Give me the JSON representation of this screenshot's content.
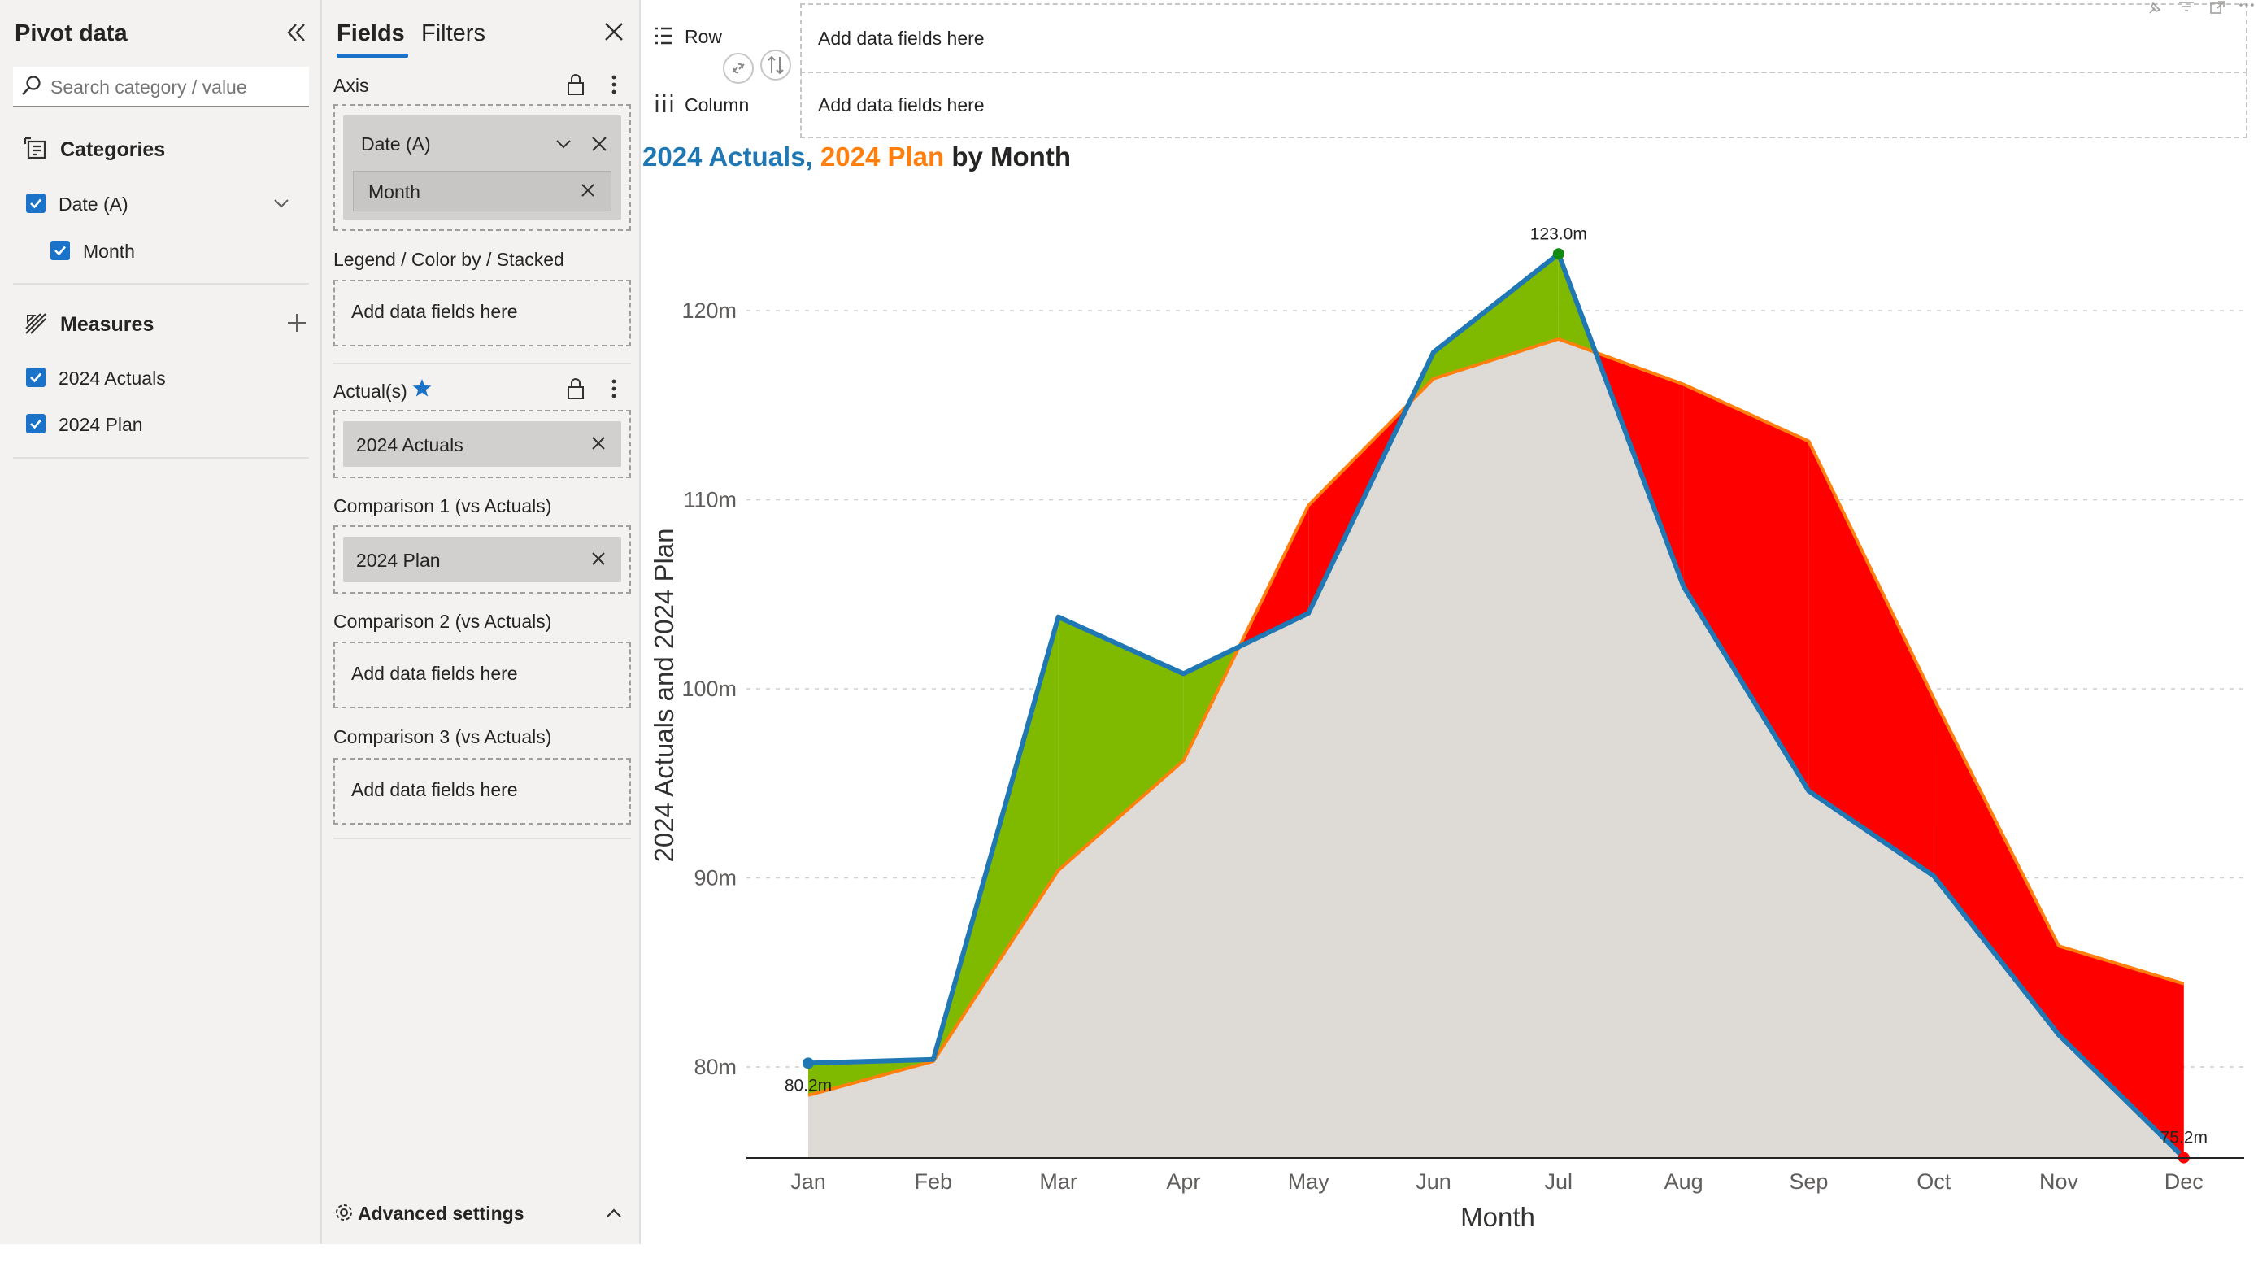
{
  "pivot": {
    "title": "Pivot data",
    "search_placeholder": "Search category / value",
    "categories_label": "Categories",
    "categories": [
      {
        "label": "Date (A)",
        "checked": true
      },
      {
        "label": "Month",
        "checked": true
      }
    ],
    "measures_label": "Measures",
    "measures": [
      {
        "label": "2024 Actuals",
        "checked": true
      },
      {
        "label": "2024 Plan",
        "checked": true
      }
    ]
  },
  "fields": {
    "tabs": [
      "Fields",
      "Filters"
    ],
    "active_tab": "Fields",
    "axis_label": "Axis",
    "axis_field": "Date (A)",
    "axis_sub_field": "Month",
    "legend_label": "Legend / Color by / Stacked",
    "legend_placeholder": "Add data fields here",
    "actuals_label": "Actual(s)",
    "actuals_field": "2024 Actuals",
    "comparison1_label": "Comparison 1 (vs Actuals)",
    "comparison1_field": "2024 Plan",
    "comparison2_label": "Comparison 2 (vs Actuals)",
    "comparison2_placeholder": "Add data fields here",
    "comparison3_label": "Comparison 3 (vs Actuals)",
    "comparison3_placeholder": "Add data fields here",
    "advanced_label": "Advanced settings"
  },
  "wells": {
    "row_label": "Row",
    "row_placeholder": "Add data fields here",
    "column_label": "Column",
    "column_placeholder": "Add data fields here"
  },
  "chart_title": {
    "part1": "2024 Actuals",
    "sep": ", ",
    "part2": "2024 Plan",
    "part3": " by Month"
  },
  "colors": {
    "actuals": "#1f77b4",
    "plan": "#ff7f0e",
    "positive": "#7fba00",
    "negative": "#ff0000",
    "baseline_fill": "#dedad6",
    "accent": "#1a73c8"
  },
  "chart_data": {
    "type": "area",
    "title": "2024 Actuals, 2024 Plan by Month",
    "xlabel": "Month",
    "ylabel": "2024 Actuals and 2024 Plan",
    "categories": [
      "Jan",
      "Feb",
      "Mar",
      "Apr",
      "May",
      "Jun",
      "Jul",
      "Aug",
      "Sep",
      "Oct",
      "Nov",
      "Dec"
    ],
    "series": [
      {
        "name": "2024 Actuals",
        "values": [
          80.2,
          80.4,
          103.8,
          100.8,
          104.0,
          117.8,
          123.0,
          105.4,
          94.6,
          90.1,
          81.7,
          75.2
        ]
      },
      {
        "name": "2024 Plan",
        "values": [
          78.5,
          80.3,
          90.4,
          96.2,
          109.7,
          116.4,
          118.5,
          116.1,
          113.1,
          99.5,
          86.4,
          84.4
        ]
      }
    ],
    "ylim": [
      75,
      126
    ],
    "yticks": [
      80,
      90,
      100,
      110,
      120
    ],
    "ytick_labels": [
      "80m",
      "90m",
      "100m",
      "110m",
      "120m"
    ],
    "grid": true,
    "annotations": [
      {
        "category": "Jan",
        "text": "80.2m"
      },
      {
        "category": "Jul",
        "text": "123.0m"
      },
      {
        "category": "Dec",
        "text": "75.2m"
      }
    ]
  }
}
